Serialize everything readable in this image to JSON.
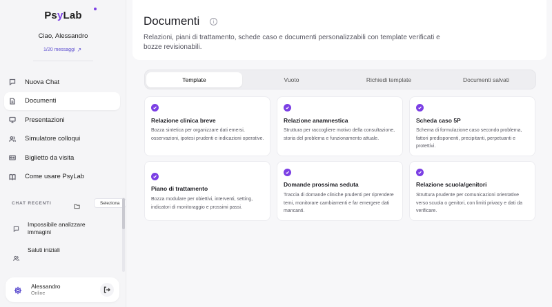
{
  "sidebar": {
    "logo": {
      "part1": "Ps",
      "part2": "y",
      "part3": "Lab"
    },
    "greeting": "Ciao, Alessandro",
    "quota": "1/20 messaggi",
    "nav": [
      {
        "label": "Nuova Chat",
        "icon": "chat-bubble-icon"
      },
      {
        "label": "Documenti",
        "icon": "document-icon",
        "active": true
      },
      {
        "label": "Presentazioni",
        "icon": "presentation-icon"
      },
      {
        "label": "Simulatore colloqui",
        "icon": "users-icon"
      },
      {
        "label": "Biglietto da visita",
        "icon": "id-card-icon"
      },
      {
        "label": "Come usare PsyLab",
        "icon": "book-icon"
      }
    ],
    "chats_header": "CHAT RECENTI",
    "select_label": "Seleziona",
    "chats": [
      {
        "title": "Impossibile analizzare immagini",
        "icon": "chat-bubble-icon"
      },
      {
        "title": "Saluti iniziali",
        "icon": "users-icon"
      }
    ],
    "user": {
      "name": "Alessandro",
      "status": "Online"
    }
  },
  "main": {
    "title": "Documenti",
    "subtitle": "Relazioni, piani di trattamento, schede caso e documenti personalizzabili con template verificati e bozze revisionabili.",
    "tabs": [
      {
        "label": "Template",
        "active": true
      },
      {
        "label": "Vuoto"
      },
      {
        "label": "Richiedi template"
      },
      {
        "label": "Documenti salvati"
      }
    ],
    "cards": [
      {
        "title": "Relazione clinica breve",
        "desc": "Bozza sintetica per organizzare dati emersi, osservazioni, ipotesi prudenti e indicazioni operative."
      },
      {
        "title": "Relazione anamnestica",
        "desc": "Struttura per raccogliere motivo della consultazione, storia del problema e funzionamento attuale."
      },
      {
        "title": "Scheda caso 5P",
        "desc": "Schema di formulazione caso secondo problema, fattori predisponenti, precipitanti, perpetuanti e protettivi."
      },
      {
        "title": "Piano di trattamento",
        "desc": "Bozza modulare per obiettivi, interventi, setting, indicatori di monitoraggio e prossimi passi."
      },
      {
        "title": "Domande prossima seduta",
        "desc": "Traccia di domande cliniche prudenti per riprendere temi, monitorare cambiamenti e far emergere dati mancanti."
      },
      {
        "title": "Relazione scuola/genitori",
        "desc": "Struttura prudente per comunicazioni orientative verso scuola o genitori, con limiti privacy e dati da verificare."
      }
    ]
  },
  "colors": {
    "accent": "#7b3fe4",
    "link": "#5b4ccf"
  }
}
